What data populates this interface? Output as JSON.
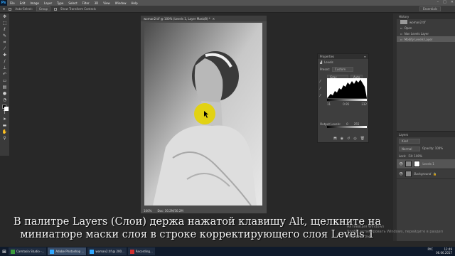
{
  "menu": {
    "items": [
      "File",
      "Edit",
      "Image",
      "Layer",
      "Type",
      "Select",
      "Filter",
      "3D",
      "View",
      "Window",
      "Help"
    ]
  },
  "options": {
    "auto_select": "Auto-Select:",
    "group": "Group",
    "show_transform": "Show Transform Controls",
    "workspace": "Essentials"
  },
  "document": {
    "tab_title": "woman2.tif @ 100% (Levels 1, Layer Mask/8) *",
    "status_zoom": "100%",
    "status_doc": "Doc: 30.2M/30.2M"
  },
  "properties": {
    "title": "Properties",
    "type": "Levels",
    "preset_label": "Preset:",
    "preset_value": "Custom",
    "channel": "Gray",
    "auto": "Auto",
    "in_black": "11",
    "in_gamma": "0.95",
    "in_white": "232",
    "output_label": "Output Levels:",
    "out_black": "0",
    "out_white": "255"
  },
  "history": {
    "tab": "History",
    "doc": "woman2.tif",
    "items": [
      "Open",
      "Non Levels Layer",
      "Modify Levels Layer"
    ],
    "active_index": 2
  },
  "layers": {
    "tab": "Layers",
    "kind": "Kind",
    "blend": "Normal",
    "opacity": "Opacity: 100%",
    "lock": "Lock:",
    "fill": "Fill: 100%",
    "rows": [
      {
        "name": "Levels 1",
        "type": "adjustment"
      },
      {
        "name": "Background",
        "type": "image"
      }
    ]
  },
  "subtitle": {
    "line1": "В палитре Layers (Слои) держа нажатой клавишу Alt, щелкните на",
    "line2": "миниатюре маски слоя в строке корректирующего слоя Levels 1"
  },
  "watermark": {
    "line1": "Активация Windows",
    "line2": "Чтобы активировать Windows, перейдите в раздел \"Параметры\"."
  },
  "taskbar": {
    "items": [
      "Camtasia Studio -...",
      "Adobe Photoshop ...",
      "woman2.tif @ 200...",
      "Recording..."
    ],
    "active_index": 1,
    "time": "12:49",
    "date": "06.06.2017",
    "lang": "РУС"
  },
  "colors": {
    "accent": "#31a8ff",
    "highlight": "#e6d400"
  }
}
